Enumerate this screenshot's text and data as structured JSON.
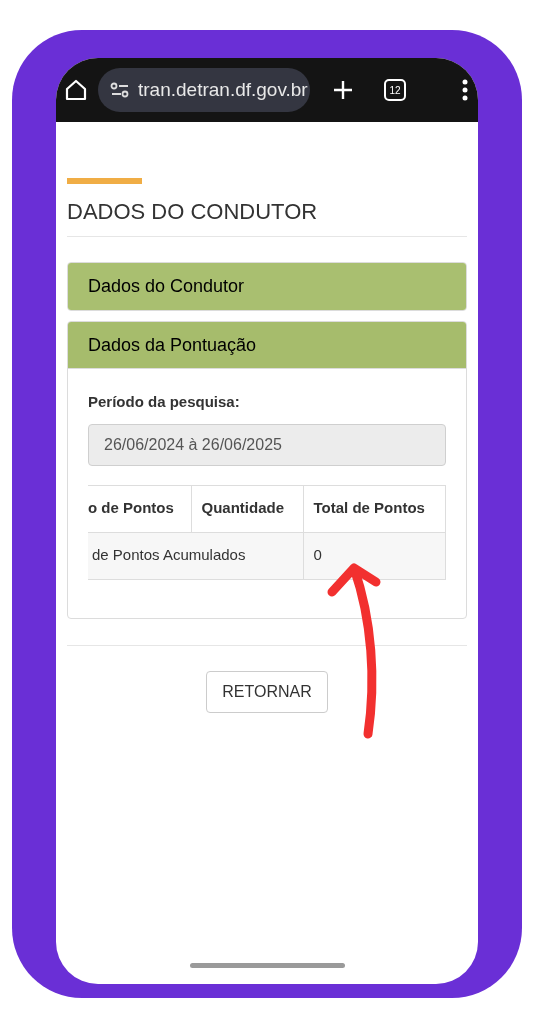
{
  "browser": {
    "url": "tran.detran.df.gov.br",
    "tab_count": "12"
  },
  "page": {
    "title": "DADOS DO CONDUTOR"
  },
  "panels": [
    {
      "title": "Dados do Condutor",
      "expanded": false
    },
    {
      "title": "Dados da Pontuação",
      "expanded": true
    }
  ],
  "search_period": {
    "label": "Período da pesquisa:",
    "value": "26/06/2024 à 26/06/2025"
  },
  "table": {
    "columns": [
      "o de Pontos",
      "Quantidade",
      "Total de Pontos"
    ],
    "rows": [
      [
        "de Pontos Acumulados",
        "",
        "0"
      ]
    ]
  },
  "buttons": [
    "RETORNAR"
  ]
}
